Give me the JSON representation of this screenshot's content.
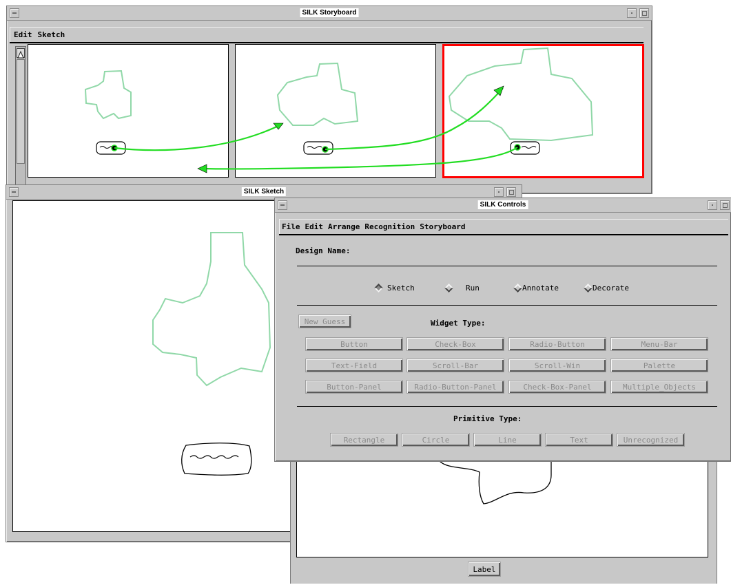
{
  "storyboard": {
    "title": "SILK Storyboard",
    "menu": [
      "Edit",
      "Sketch"
    ],
    "scroll_arrow": "up-arrow-icon"
  },
  "sketch": {
    "title": "SILK Sketch",
    "label_button": "Label"
  },
  "controls": {
    "title": "SILK Controls",
    "menu": [
      "File",
      "Edit",
      "Arrange",
      "Recognition",
      "Storyboard"
    ],
    "design_name_label": "Design Name:",
    "modes": [
      {
        "label": "Sketch",
        "selected": true
      },
      {
        "label": "Run",
        "selected": false
      },
      {
        "label": "Annotate",
        "selected": false
      },
      {
        "label": "Decorate",
        "selected": false
      }
    ],
    "new_guess": "New Guess",
    "widget_type_label": "Widget Type:",
    "widgets": [
      [
        "Button",
        "Check-Box",
        "Radio-Button",
        "Menu-Bar"
      ],
      [
        "Text-Field",
        "Scroll-Bar",
        "Scroll-Win",
        "Palette"
      ],
      [
        "Button-Panel",
        "Radio-Button-Panel",
        "Check-Box-Panel",
        "Multiple_Objects"
      ]
    ],
    "primitive_type_label": "Primitive Type:",
    "primitives": [
      "Rectangle",
      "Circle",
      "Line",
      "Text",
      "Unrecognized"
    ]
  },
  "colors": {
    "selected_frame": "#ff0000",
    "transition_arrow": "#22dd22",
    "sketch_stroke": "#90d8a8"
  }
}
